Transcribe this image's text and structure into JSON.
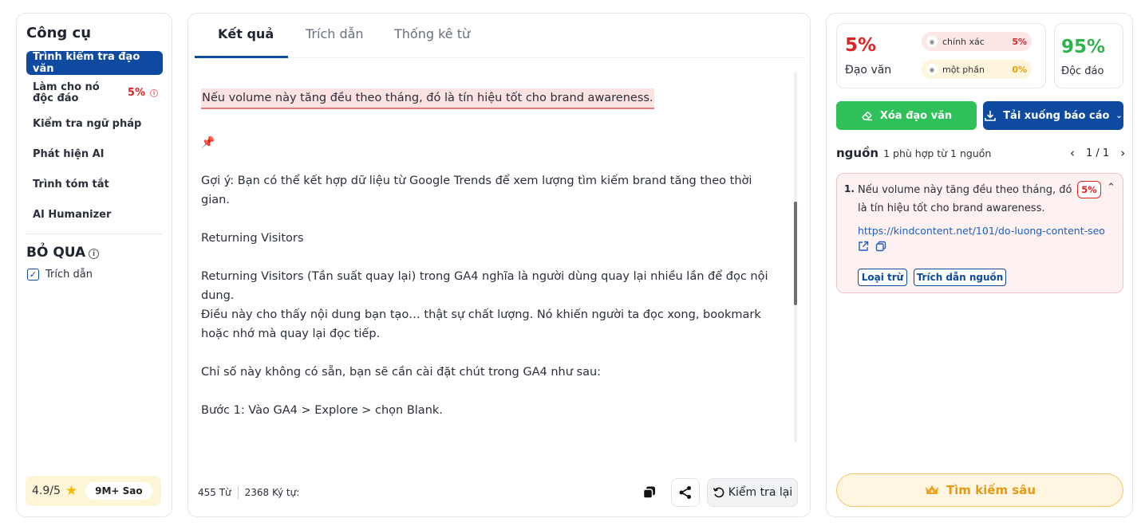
{
  "left": {
    "title": "Công cụ",
    "items": [
      {
        "label": "Trình kiểm tra đạo văn"
      },
      {
        "label": "Làm cho nó độc đáo",
        "pct": "5%"
      },
      {
        "label": "Kiểm tra ngữ pháp"
      },
      {
        "label": "Phát hiện AI"
      },
      {
        "label": "Trình tóm tắt"
      },
      {
        "label": "AI Humanizer"
      }
    ],
    "skip_title": "BỎ QUA",
    "cite_label": "Trích dẫn",
    "rating_score": "4.9/5",
    "rating_badge": "9M+ Sao"
  },
  "tabs": [
    "Kết quả",
    "Trích dẫn",
    "Thống kê từ"
  ],
  "content": {
    "highlight": "Nếu volume này tăng đều theo tháng, đó là tín hiệu tốt cho brand awareness.",
    "pin": "📌",
    "p1": "Gợi ý: Bạn có thể kết hợp dữ liệu từ Google Trends để xem lượng tìm kiếm brand tăng theo thời gian.",
    "p2": "Returning Visitors",
    "p3": "Returning Visitors (Tần suất quay lại) trong GA4 nghĩa là người dùng quay lại nhiều lần để đọc nội dung.",
    "p4": "Điều này cho thấy nội dung bạn tạo… thật sự chất lượng. Nó khiến người ta đọc xong, bookmark hoặc nhớ mà quay lại đọc tiếp.",
    "p5": "Chỉ số này không có sẵn, bạn sẽ cần cài đặt chút trong GA4 như sau:",
    "p6": "Bước 1: Vào GA4 > Explore > chọn Blank."
  },
  "footer": {
    "words": "455 Từ",
    "chars": "2368 Ký tự:",
    "recheck": "Kiểm tra lại"
  },
  "right": {
    "plag_pct": "5%",
    "plag_label": "Đạo văn",
    "exact_label": "chính xác",
    "exact_val": "5%",
    "partial_label": "một phần",
    "partial_val": "0%",
    "unique_pct": "95%",
    "unique_label": "Độc đáo",
    "remove_btn": "Xóa đạo văn",
    "download_btn": "Tải xuống báo cáo",
    "sources_title": "nguồn",
    "sources_sub": "1 phù hợp từ 1 nguồn",
    "pager": "1 / 1",
    "source": {
      "num": "1.",
      "text": "Nếu volume này tăng đều theo tháng, đó là tín hiệu tốt cho brand awareness.",
      "pct": "5%",
      "url": "https://kindcontent.net/101/do-luong-content-seo",
      "exclude": "Loại trừ",
      "cite": "Trích dẫn nguồn"
    },
    "deep_search": "Tìm kiếm sâu"
  },
  "colors": {
    "accent": "#0d4aa0",
    "danger": "#e02424",
    "success": "#2fc05a",
    "gold": "#e69a15"
  }
}
